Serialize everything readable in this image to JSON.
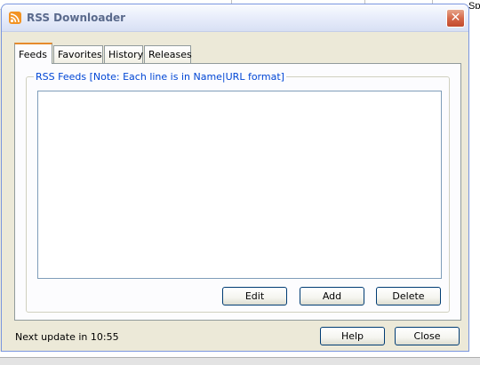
{
  "background": {
    "partial_text": "Spe"
  },
  "window": {
    "title": "RSS Downloader",
    "close_label": "✕"
  },
  "tabs": [
    {
      "label": "Feeds",
      "active": true
    },
    {
      "label": "Favorites",
      "active": false
    },
    {
      "label": "History",
      "active": false
    },
    {
      "label": "Releases",
      "active": false
    }
  ],
  "feeds_panel": {
    "group_label": "RSS Feeds [Note: Each line is in Name|URL format]",
    "feeds_value": "",
    "buttons": {
      "edit": "Edit",
      "add": "Add",
      "delete": "Delete"
    }
  },
  "footer": {
    "status": "Next update in 10:55",
    "help": "Help",
    "close": "Close"
  },
  "colors": {
    "tab_highlight": "#e68b2c",
    "group_label": "#0046d5",
    "rss_icon": "#f29322"
  }
}
